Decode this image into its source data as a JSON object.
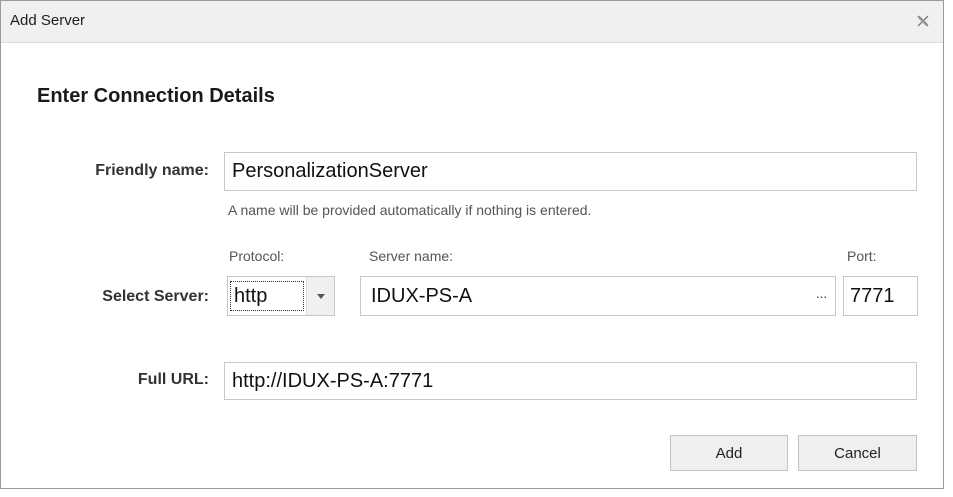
{
  "window": {
    "title": "Add Server"
  },
  "heading": "Enter Connection Details",
  "friendly_name": {
    "label": "Friendly name:",
    "value": "PersonalizationServer",
    "hint": "A name will be provided automatically if nothing is entered."
  },
  "select_server": {
    "label": "Select Server:",
    "protocol_label": "Protocol:",
    "protocol_value": "http",
    "server_name_label": "Server name:",
    "server_name_value": "IDUX-PS-A",
    "browse_label": "···",
    "port_label": "Port:",
    "port_value": "7771"
  },
  "full_url": {
    "label": "Full URL:",
    "value": "http://IDUX-PS-A:7771"
  },
  "buttons": {
    "add": "Add",
    "cancel": "Cancel"
  },
  "icons": {
    "close": "close-icon",
    "dropdown": "chevron-down-icon",
    "browse": "ellipsis-icon"
  }
}
